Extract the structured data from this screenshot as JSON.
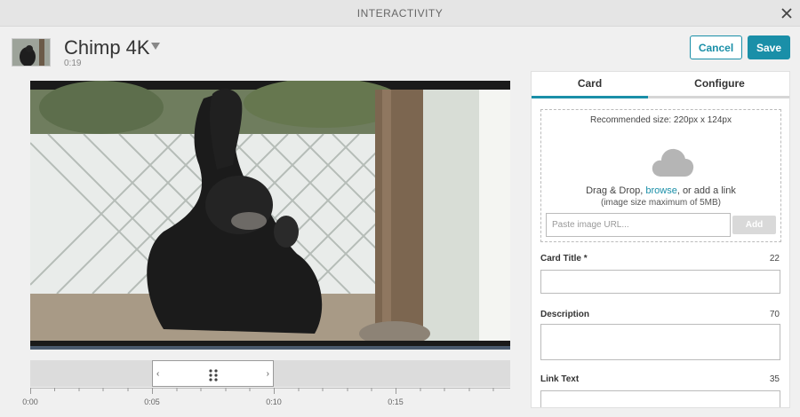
{
  "window": {
    "title": "INTERACTIVITY",
    "close_icon": "close-icon"
  },
  "header": {
    "video_title": "Chimp 4K",
    "duration": "0:19",
    "cancel_label": "Cancel",
    "save_label": "Save",
    "accent_color": "#1a8fa8"
  },
  "timeline": {
    "tick_labels": [
      "0:00",
      "0:05",
      "0:10",
      "0:15"
    ],
    "selection_start": "0:05",
    "selection_end": "0:10",
    "left_arrow": "‹",
    "right_arrow": "›"
  },
  "panel": {
    "tabs": [
      {
        "label": "Card",
        "active": true
      },
      {
        "label": "Configure",
        "active": false
      }
    ],
    "upload": {
      "recommended": "Recommended size: 220px x 124px",
      "drag_prefix": "Drag & Drop, ",
      "browse": "browse",
      "drag_suffix": ", or add a link",
      "limit": "(image size maximum of 5MB)",
      "url_placeholder": "Paste image URL...",
      "add_label": "Add"
    },
    "fields": [
      {
        "label": "Card Title *",
        "count": "22"
      },
      {
        "label": "Description",
        "count": "70"
      },
      {
        "label": "Link Text",
        "count": "35"
      }
    ]
  }
}
